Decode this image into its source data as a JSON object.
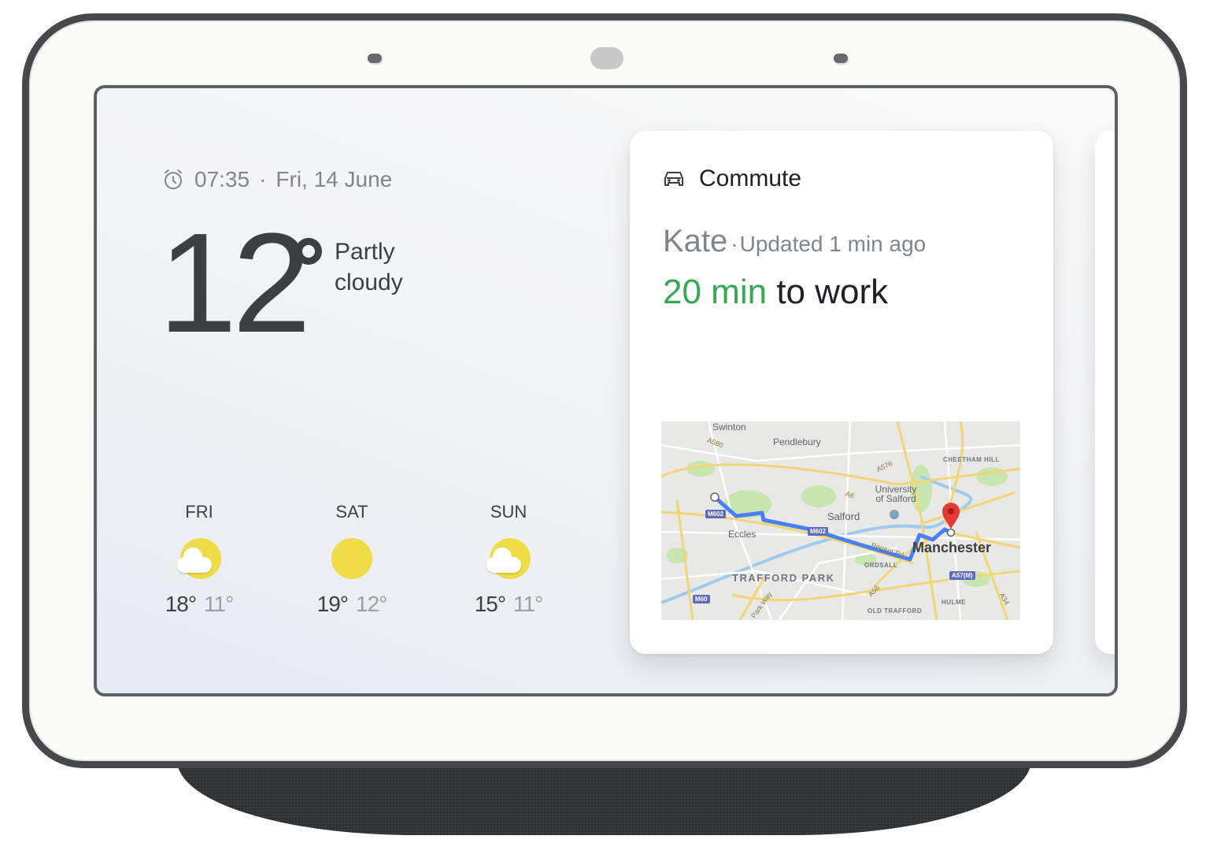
{
  "device": {
    "name": "Smart display"
  },
  "clock": {
    "icon": "alarm-clock-icon",
    "time": "07:35",
    "separator": "·",
    "date": "Fri, 14 June"
  },
  "weather": {
    "current_temp": "12",
    "degree_symbol": "°",
    "condition_line1": "Partly",
    "condition_line2": "cloudy",
    "forecast": [
      {
        "day": "FRI",
        "icon": "partly-cloudy-icon",
        "high": "18°",
        "low": "11°"
      },
      {
        "day": "SAT",
        "icon": "sunny-icon",
        "high": "19°",
        "low": "12°"
      },
      {
        "day": "SUN",
        "icon": "partly-cloudy-icon",
        "high": "15°",
        "low": "11°"
      }
    ]
  },
  "commute_card": {
    "icon": "car-icon",
    "title": "Commute",
    "person": "Kate",
    "separator": "·",
    "updated": "Updated 1 min ago",
    "eta_time": "20 min",
    "eta_destination": "to work",
    "colors": {
      "eta": "#34a853",
      "route": "#4a80f5",
      "pin": "#e53935"
    },
    "map": {
      "places": [
        "Swinton",
        "Pendlebury",
        "CHEETHAM HILL",
        "University of Salford",
        "Salford",
        "Eccles",
        "Manchester",
        "ORDSALL",
        "TRAFFORD PARK",
        "HULME",
        "OLD TRAFFORD"
      ],
      "roads": [
        "A580",
        "A576",
        "A6",
        "A56",
        "A34",
        "Regent Rd",
        "Park Way"
      ],
      "shields": [
        "M602",
        "M602",
        "M60",
        "A57(M)"
      ]
    }
  }
}
